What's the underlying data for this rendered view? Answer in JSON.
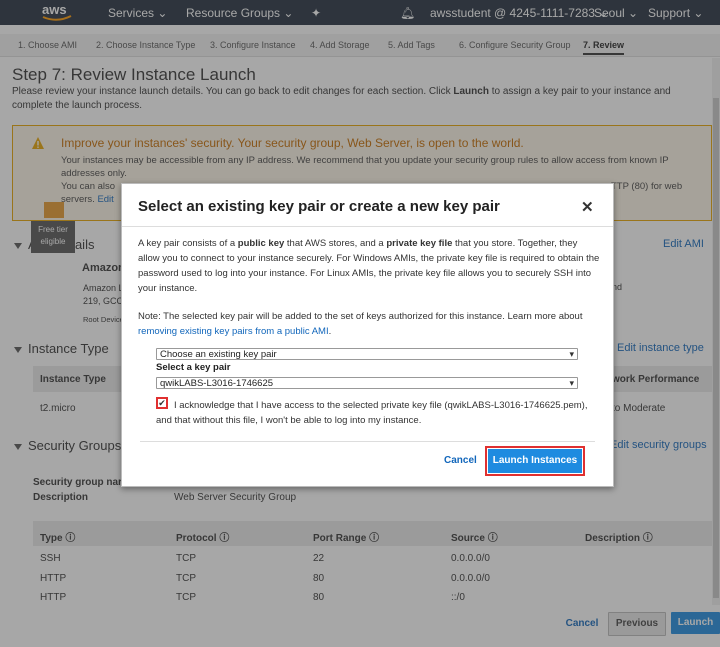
{
  "nav": {
    "brand": "aws",
    "services": "Services",
    "resource_groups": "Resource Groups",
    "account": "awsstudent @ 4245-1111-7283",
    "region": "Seoul",
    "support": "Support"
  },
  "wizard_steps": [
    "1. Choose AMI",
    "2. Choose Instance Type",
    "3. Configure Instance",
    "4. Add Storage",
    "5. Add Tags",
    "6. Configure Security Group",
    "7. Review"
  ],
  "page": {
    "title": "Step 7: Review Instance Launch",
    "intro_1": "Please review your instance launch details. You can go back to edit changes for each section. Click ",
    "intro_bold": "Launch",
    "intro_2": " to assign a key pair to your instance and complete the launch process."
  },
  "warning": {
    "title": "Improve your instances' security. Your security group, Web Server, is open to the world.",
    "line1": "Your instances may be accessible from any IP address. We recommend that you update your security group rules to allow access from known IP addresses only.",
    "line2a": "You can also",
    "line2b": "TTP (80) for web",
    "line3a": "servers.",
    "line3b": "Edit"
  },
  "ami": {
    "header": "AMI Details",
    "edit": "Edit AMI",
    "free_tier": "Free tier eligible",
    "name": "Amazon",
    "desc1": "Amazon L",
    "desc2": "219, GCC",
    "desc3": "Root Device",
    "right_fragment": "nd"
  },
  "instance_type": {
    "header": "Instance Type",
    "edit": "Edit instance type",
    "col1": "Instance Type",
    "col_right": "work Performance",
    "value": "t2.micro",
    "value_right": "to Moderate"
  },
  "security_groups": {
    "header": "Security Groups",
    "edit": "Edit security groups",
    "name_label": "Security group nar",
    "desc_label": "Description",
    "desc_value": "Web Server Security Group",
    "columns": [
      "Type",
      "Protocol",
      "Port Range",
      "Source",
      "Description"
    ],
    "rows": [
      [
        "SSH",
        "TCP",
        "22",
        "0.0.0.0/0"
      ],
      [
        "HTTP",
        "TCP",
        "80",
        "0.0.0.0/0"
      ],
      [
        "HTTP",
        "TCP",
        "80",
        "::/0"
      ]
    ]
  },
  "bottom": {
    "cancel": "Cancel",
    "previous": "Previous",
    "launch": "Launch"
  },
  "modal": {
    "title": "Select an existing key pair or create a new key pair",
    "close": "✕",
    "p1_a": "A key pair consists of a ",
    "p1_b": "public key",
    "p1_c": " that AWS stores, and a ",
    "p1_d": "private key file",
    "p1_e": " that you store. Together, they allow you to connect to your instance securely. For Windows AMIs, the private key file is required to obtain the password used to log into your instance. For Linux AMIs, the private key file allows you to securely SSH into your instance.",
    "note_a": "Note: The selected key pair will be added to the set of keys authorized for this instance. Learn more about ",
    "note_link": "removing existing key pairs from a public AMI",
    "note_b": ".",
    "select_mode": "Choose an existing key pair",
    "select_label": "Select a key pair",
    "key_pair": "qwikLABS-L3016-1746625",
    "ack": "I acknowledge that I have access to the selected private key file (qwikLABS-L3016-1746625.pem), and that without this file, I won't be able to log into my instance.",
    "cancel": "Cancel",
    "launch": "Launch Instances"
  }
}
